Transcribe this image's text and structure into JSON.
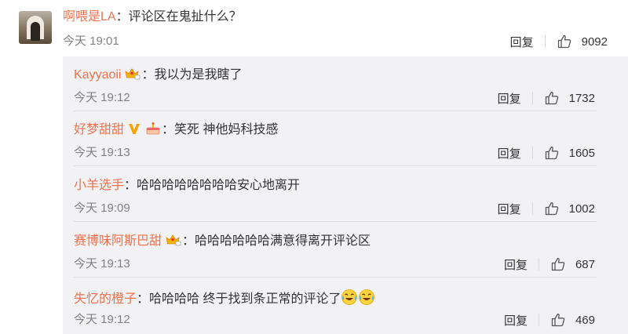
{
  "main_comment": {
    "username": "啊喂是LA",
    "text": "评论区在鬼扯什么？",
    "time": "今天 19:01",
    "reply_label": "回复",
    "likes": "9092"
  },
  "replies": [
    {
      "username": "Kayyaoii",
      "text": "我以为是我瞎了",
      "time": "今天 19:12",
      "reply_label": "回复",
      "likes": "1732"
    },
    {
      "username": "好梦甜甜",
      "text": "笑死 神他妈科技感",
      "time": "今天 19:13",
      "reply_label": "回复",
      "likes": "1605"
    },
    {
      "username": "小羊选手",
      "text": "哈哈哈哈哈哈哈哈安心地离开",
      "time": "今天 19:09",
      "reply_label": "回复",
      "likes": "1002"
    },
    {
      "username": "赛博味阿斯巴甜",
      "text": "哈哈哈哈哈哈满意得离开评论区",
      "time": "今天 19:13",
      "reply_label": "回复",
      "likes": "687"
    },
    {
      "username": "失忆的橙子",
      "text": "哈哈哈哈 终于找到条正常的评论了",
      "time": "今天 19:12",
      "reply_label": "回复",
      "likes": "469"
    }
  ],
  "colon": "：",
  "colors": {
    "username": "#eb7350",
    "text": "#333333",
    "time": "#808080",
    "reply_bg": "#f2f2f5"
  },
  "icons": {
    "like": "thumbs-up-icon",
    "vip": "crown-badge-icon",
    "verified": "v-badge-icon",
    "laugh": "laughing-tears-emoji"
  }
}
